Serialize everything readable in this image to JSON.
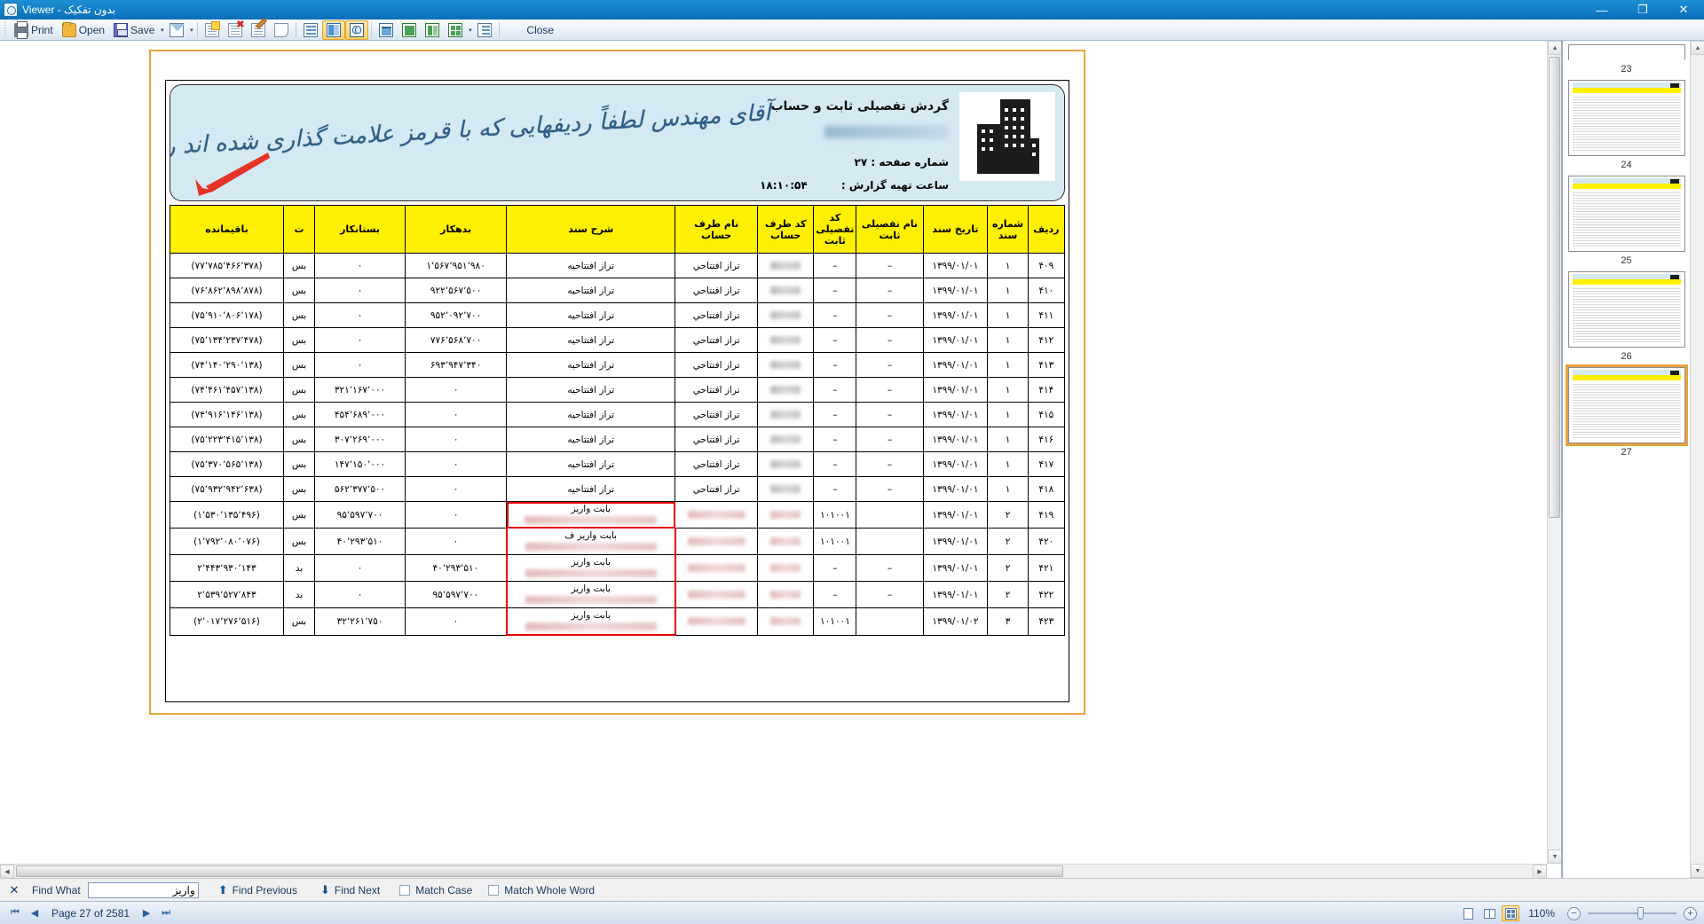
{
  "window": {
    "title": "بدون تفکیک - Viewer",
    "minimize": "—",
    "maximize": "❐",
    "close": "✕"
  },
  "toolbar": {
    "print_label": "Print",
    "open_label": "Open",
    "save_label": "Save",
    "close_label": "Close",
    "caret": "▾"
  },
  "report": {
    "title": "گردش تفصیلی ثابت و حساب",
    "page_label": "شماره صفحه :",
    "page_value": "۲۷",
    "time_label": "ساعت تهیه گزارش :",
    "time_value": "۱۸:۱۰:۵۴",
    "annotation": "آقای مهندس لطفاً ردیفهایی که با قرمز علامت گذاری شده اند را ملاحظه نمایید",
    "columns": [
      "ردیف",
      "شماره سند",
      "تاریخ سند",
      "نام تفصیلی ثابت",
      "کد تفصیلی ثابت",
      "نام طرف حساب",
      "کد طرف حساب",
      "شرح سند",
      "بدهکار",
      "بستانکار",
      "ت",
      "باقیمانده"
    ],
    "rows": [
      {
        "radif": "۴۰۹",
        "sanad": "۱",
        "tarikh": "۱۳۹۹/۰۱/۰۱",
        "kod_tafsili": "–",
        "nam_tafsili": "–",
        "kod_taraf": "",
        "nam_taraf": "تراز افتتاحي",
        "sharh": "تراز افتتاحيه",
        "bedehkar": "۱٬۵۶۷٬۹۵۱٬۹۸۰",
        "bestankar": "۰",
        "t": "بس",
        "baghimande": "(۷۷٬۷۸۵٬۴۶۶٬۳۷۸)",
        "redbox": "none"
      },
      {
        "radif": "۴۱۰",
        "sanad": "۱",
        "tarikh": "۱۳۹۹/۰۱/۰۱",
        "kod_tafsili": "–",
        "nam_tafsili": "–",
        "kod_taraf": "",
        "nam_taraf": "تراز افتتاحي",
        "sharh": "تراز افتتاحيه",
        "bedehkar": "۹۲۲٬۵۶۷٬۵۰۰",
        "bestankar": "۰",
        "t": "بس",
        "baghimande": "(۷۶٬۸۶۲٬۸۹۸٬۸۷۸)",
        "redbox": "none"
      },
      {
        "radif": "۴۱۱",
        "sanad": "۱",
        "tarikh": "۱۳۹۹/۰۱/۰۱",
        "kod_tafsili": "–",
        "nam_tafsili": "–",
        "kod_taraf": "",
        "nam_taraf": "تراز افتتاحي",
        "sharh": "تراز افتتاحيه",
        "bedehkar": "۹۵۲٬۰۹۲٬۷۰۰",
        "bestankar": "۰",
        "t": "بس",
        "baghimande": "(۷۵٬۹۱۰٬۸۰۶٬۱۷۸)",
        "redbox": "none"
      },
      {
        "radif": "۴۱۲",
        "sanad": "۱",
        "tarikh": "۱۳۹۹/۰۱/۰۱",
        "kod_tafsili": "–",
        "nam_tafsili": "–",
        "kod_taraf": "",
        "nam_taraf": "تراز افتتاحي",
        "sharh": "تراز افتتاحيه",
        "bedehkar": "۷۷۶٬۵۶۸٬۷۰۰",
        "bestankar": "۰",
        "t": "بس",
        "baghimande": "(۷۵٬۱۳۴٬۲۳۷٬۴۷۸)",
        "redbox": "none"
      },
      {
        "radif": "۴۱۳",
        "sanad": "۱",
        "tarikh": "۱۳۹۹/۰۱/۰۱",
        "kod_tafsili": "–",
        "nam_tafsili": "–",
        "kod_taraf": "",
        "nam_taraf": "تراز افتتاحي",
        "sharh": "تراز افتتاحيه",
        "bedehkar": "۶۹۳٬۹۴۷٬۳۴۰",
        "bestankar": "۰",
        "t": "بس",
        "baghimande": "(۷۴٬۱۴۰٬۲۹۰٬۱۳۸)",
        "redbox": "none"
      },
      {
        "radif": "۴۱۴",
        "sanad": "۱",
        "tarikh": "۱۳۹۹/۰۱/۰۱",
        "kod_tafsili": "–",
        "nam_tafsili": "–",
        "kod_taraf": "",
        "nam_taraf": "تراز افتتاحي",
        "sharh": "تراز افتتاحيه",
        "bedehkar": "۰",
        "bestankar": "۳۲۱٬۱۶۷٬۰۰۰",
        "t": "بس",
        "baghimande": "(۷۴٬۴۶۱٬۴۵۷٬۱۳۸)",
        "redbox": "none"
      },
      {
        "radif": "۴۱۵",
        "sanad": "۱",
        "tarikh": "۱۳۹۹/۰۱/۰۱",
        "kod_tafsili": "–",
        "nam_tafsili": "–",
        "kod_taraf": "",
        "nam_taraf": "تراز افتتاحي",
        "sharh": "تراز افتتاحيه",
        "bedehkar": "۰",
        "bestankar": "۴۵۴٬۶۸۹٬۰۰۰",
        "t": "بس",
        "baghimande": "(۷۴٬۹۱۶٬۱۴۶٬۱۳۸)",
        "redbox": "none"
      },
      {
        "radif": "۴۱۶",
        "sanad": "۱",
        "tarikh": "۱۳۹۹/۰۱/۰۱",
        "kod_tafsili": "–",
        "nam_tafsili": "–",
        "kod_taraf": "",
        "nam_taraf": "تراز افتتاحي",
        "sharh": "تراز افتتاحيه",
        "bedehkar": "۰",
        "bestankar": "۳۰۷٬۲۶۹٬۰۰۰",
        "t": "بس",
        "baghimande": "(۷۵٬۲۲۳٬۴۱۵٬۱۳۸)",
        "redbox": "none"
      },
      {
        "radif": "۴۱۷",
        "sanad": "۱",
        "tarikh": "۱۳۹۹/۰۱/۰۱",
        "kod_tafsili": "–",
        "nam_tafsili": "–",
        "kod_taraf": "",
        "nam_taraf": "تراز افتتاحي",
        "sharh": "تراز افتتاحيه",
        "bedehkar": "۰",
        "bestankar": "۱۴۷٬۱۵۰٬۰۰۰",
        "t": "بس",
        "baghimande": "(۷۵٬۳۷۰٬۵۶۵٬۱۳۸)",
        "redbox": "none"
      },
      {
        "radif": "۴۱۸",
        "sanad": "۱",
        "tarikh": "۱۳۹۹/۰۱/۰۱",
        "kod_tafsili": "–",
        "nam_tafsili": "–",
        "kod_taraf": "",
        "nam_taraf": "تراز افتتاحي",
        "sharh": "تراز افتتاحيه",
        "bedehkar": "۰",
        "bestankar": "۵۶۲٬۳۷۷٬۵۰۰",
        "t": "بس",
        "baghimande": "(۷۵٬۹۳۲٬۹۴۲٬۶۳۸)",
        "redbox": "none"
      },
      {
        "radif": "۴۱۹",
        "sanad": "۲",
        "tarikh": "۱۳۹۹/۰۱/۰۱",
        "kod_tafsili": "۱۰۱۰۰۱",
        "nam_tafsili": "",
        "kod_taraf": "",
        "nam_taraf": "",
        "sharh": "بابت واریز",
        "bedehkar": "۰",
        "bestankar": "۹۵٬۵۹۷٬۷۰۰",
        "t": "بس",
        "baghimande": "(۱٬۵۳۰٬۱۳۵٬۴۹۶)",
        "redbox": "full"
      },
      {
        "radif": "۴۲۰",
        "sanad": "۲",
        "tarikh": "۱۳۹۹/۰۱/۰۱",
        "kod_tafsili": "۱۰۱۰۰۱",
        "nam_tafsili": "",
        "kod_taraf": "",
        "nam_taraf": "",
        "sharh": "بابت واریز ف",
        "bedehkar": "۰",
        "bestankar": "۴۰٬۲۹۳٬۵۱۰",
        "t": "بس",
        "baghimande": "(۱٬۷۹۲٬۰۸۰٬۰۷۶)",
        "redbox": "mid"
      },
      {
        "radif": "۴۲۱",
        "sanad": "۲",
        "tarikh": "۱۳۹۹/۰۱/۰۱",
        "kod_tafsili": "–",
        "nam_tafsili": "–",
        "kod_taraf": "",
        "nam_taraf": "",
        "sharh": "بابت واریز",
        "bedehkar": "۴۰٬۲۹۳٬۵۱۰",
        "bestankar": "۰",
        "t": "بد",
        "baghimande": "۲٬۴۴۳٬۹۳۰٬۱۴۳",
        "redbox": "mid"
      },
      {
        "radif": "۴۲۲",
        "sanad": "۲",
        "tarikh": "۱۳۹۹/۰۱/۰۱",
        "kod_tafsili": "–",
        "nam_tafsili": "–",
        "kod_taraf": "",
        "nam_taraf": "",
        "sharh": "بابت واریز",
        "bedehkar": "۹۵٬۵۹۷٬۷۰۰",
        "bestankar": "۰",
        "t": "بد",
        "baghimande": "۲٬۵۳۹٬۵۲۷٬۸۴۳",
        "redbox": "mid"
      },
      {
        "radif": "۴۲۳",
        "sanad": "۳",
        "tarikh": "۱۳۹۹/۰۱/۰۲",
        "kod_tafsili": "۱۰۱۰۰۱",
        "nam_tafsili": "",
        "kod_taraf": "",
        "nam_taraf": "",
        "sharh": "بابت واریز",
        "bedehkar": "۰",
        "bestankar": "۳۲٬۲۶۱٬۷۵۰",
        "t": "بس",
        "baghimande": "(۲٬۰۱۷٬۲۷۶٬۵۱۶)",
        "redbox": "bottom"
      }
    ]
  },
  "thumbnails": [
    {
      "num": "23",
      "selected": false
    },
    {
      "num": "24",
      "selected": false
    },
    {
      "num": "25",
      "selected": false
    },
    {
      "num": "26",
      "selected": false
    },
    {
      "num": "27",
      "selected": true
    }
  ],
  "findbar": {
    "close": "✕",
    "label": "Find What",
    "value": "واریز",
    "placeholder": "",
    "find_previous": "Find Previous",
    "find_next": "Find Next",
    "match_case": "Match Case",
    "match_whole_word": "Match Whole Word",
    "up_arrow": "⬆",
    "down_arrow": "⬇"
  },
  "statusbar": {
    "first": "⏮",
    "prev": "◀",
    "page_text": "Page 27 of 2581",
    "next": "▶",
    "last": "⏭",
    "zoom_level": "110%",
    "zoom_out": "−",
    "zoom_in": "+"
  },
  "colors": {
    "titlebar": "#1d8fd4",
    "table_header": "#ffef00",
    "report_band": "#d5e9f2",
    "page_border": "#e8a33d",
    "annotation": "#2f5d86",
    "arrow": "#e63329",
    "redbox": "#e60000"
  }
}
